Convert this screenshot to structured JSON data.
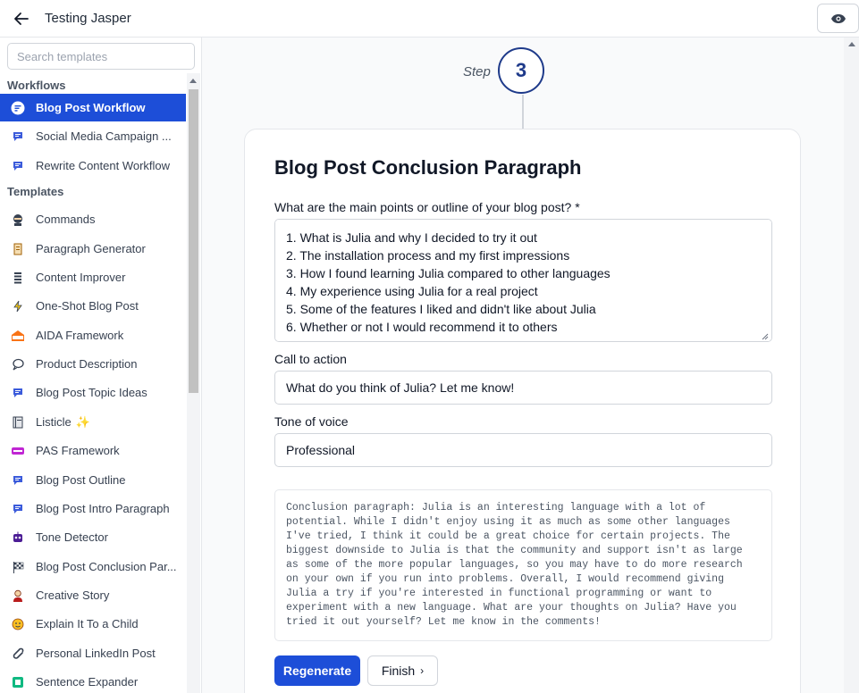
{
  "header": {
    "title": "Testing Jasper",
    "back_icon": "arrow-left-icon",
    "preview_icon": "eye-icon"
  },
  "sidebar": {
    "search_placeholder": "Search templates",
    "workflows_heading": "Workflows",
    "templates_heading": "Templates",
    "workflows": [
      {
        "label": "Blog Post Workflow",
        "icon": "chat-bubble-icon",
        "active": true
      },
      {
        "label": "Social Media Campaign ...",
        "icon": "message-icon"
      },
      {
        "label": "Rewrite Content Workflow",
        "icon": "message-icon"
      }
    ],
    "templates": [
      {
        "label": "Commands",
        "icon": "ninja-icon"
      },
      {
        "label": "Paragraph Generator",
        "icon": "scroll-icon"
      },
      {
        "label": "Content Improver",
        "icon": "list-icon"
      },
      {
        "label": "One-Shot Blog Post",
        "icon": "lightning-icon"
      },
      {
        "label": "AIDA Framework",
        "icon": "aida-badge-icon"
      },
      {
        "label": "Product Description",
        "icon": "speech-bubble-icon"
      },
      {
        "label": "Blog Post Topic Ideas",
        "icon": "message-icon"
      },
      {
        "label": "Listicle",
        "icon": "notebook-icon",
        "suffix": "✨"
      },
      {
        "label": "PAS Framework",
        "icon": "pas-badge-icon"
      },
      {
        "label": "Blog Post Outline",
        "icon": "message-icon"
      },
      {
        "label": "Blog Post Intro Paragraph",
        "icon": "message-icon"
      },
      {
        "label": "Tone Detector",
        "icon": "robot-icon"
      },
      {
        "label": "Blog Post Conclusion Par...",
        "icon": "checkered-flag-icon"
      },
      {
        "label": "Creative Story",
        "icon": "person-icon"
      },
      {
        "label": "Explain It To a Child",
        "icon": "child-face-icon"
      },
      {
        "label": "Personal LinkedIn Post",
        "icon": "paperclip-icon"
      },
      {
        "label": "Sentence Expander",
        "icon": "expand-icon"
      }
    ]
  },
  "step": {
    "label": "Step",
    "number": "3"
  },
  "card": {
    "title": "Blog Post Conclusion Paragraph",
    "outline_label": "What are the main points or outline of your blog post? *",
    "outline_value": "1. What is Julia and why I decided to try it out\n2. The installation process and my first impressions\n3. How I found learning Julia compared to other languages\n4. My experience using Julia for a real project\n5. Some of the features I liked and didn't like about Julia\n6. Whether or not I would recommend it to others",
    "cta_label": "Call to action",
    "cta_value": "What do you think of Julia? Let me know!",
    "tone_label": "Tone of voice",
    "tone_value": "Professional",
    "output_text": "Conclusion paragraph: Julia is an interesting language with a lot of potential. While I didn't enjoy using it as much as some other languages I've tried, I think it could be a great choice for certain projects. The biggest downside to Julia is that the community and support isn't as large as some of the more popular languages, so you may have to do more research on your own if you run into problems. Overall, I would recommend giving Julia a try if you're interested in functional programming or want to experiment with a new language. What are your thoughts on Julia? Have you tried it out yourself? Let me know in the comments!",
    "regenerate_label": "Regenerate",
    "finish_label": "Finish"
  },
  "colors": {
    "accent": "#1d4ed8",
    "step_circle": "#1e3a8a"
  }
}
